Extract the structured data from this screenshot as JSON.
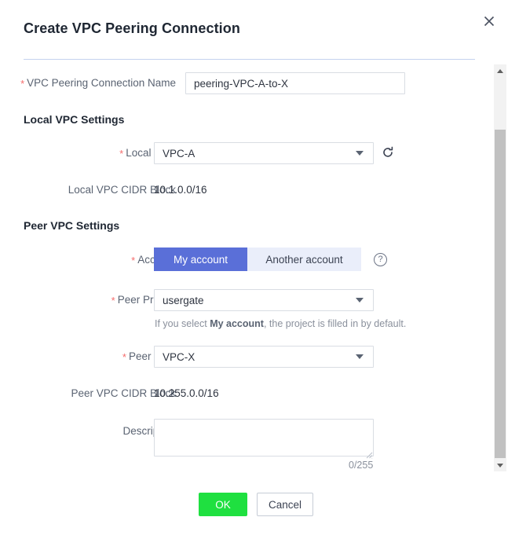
{
  "dialog": {
    "title": "Create VPC Peering Connection",
    "close_icon": "close-icon"
  },
  "fields": {
    "name": {
      "label": "VPC Peering Connection Name",
      "required": true,
      "value": "peering-VPC-A-to-X",
      "placeholder": ""
    },
    "local_vpc": {
      "label": "Local VPC",
      "required": true,
      "value": "VPC-A",
      "refresh_icon": "refresh-icon"
    },
    "local_cidr": {
      "label": "Local VPC CIDR Block",
      "required": false,
      "value": "10.1.0.0/16"
    },
    "account": {
      "label": "Account",
      "required": true,
      "options": [
        "My account",
        "Another account"
      ],
      "selected": "My account",
      "help_icon": "help-icon"
    },
    "peer_project": {
      "label": "Peer Project",
      "required": true,
      "value": "usergate",
      "hint_prefix": "If you select ",
      "hint_bold": "My account",
      "hint_suffix": ", the project is filled in by default."
    },
    "peer_vpc": {
      "label": "Peer VPC",
      "required": true,
      "value": "VPC-X"
    },
    "peer_cidr": {
      "label": "Peer VPC CIDR Block",
      "required": false,
      "value": "10.255.0.0/16"
    },
    "description": {
      "label": "Description",
      "required": false,
      "value": "",
      "placeholder": "",
      "counter": "0/255"
    }
  },
  "sections": {
    "local": "Local VPC Settings",
    "peer": "Peer VPC Settings"
  },
  "footer": {
    "ok": "OK",
    "cancel": "Cancel"
  },
  "colors": {
    "accent": "#5a6fd8",
    "ok_green": "#1fe040",
    "required_red": "#f56c6c",
    "divider": "#c5d2ef"
  },
  "required_marker": "*"
}
